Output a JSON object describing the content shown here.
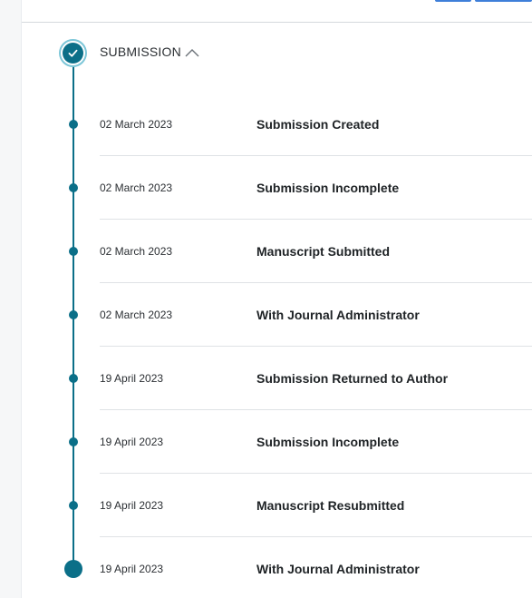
{
  "section": {
    "title": "SUBMISSION",
    "collapse_icon": "chevron-up-icon",
    "status_icon": "check-icon"
  },
  "colors": {
    "accent": "#0b6f88",
    "divider": "#dfe2e5",
    "text": "#1f2326"
  },
  "events": [
    {
      "date": "02 March 2023",
      "title": "Submission Created"
    },
    {
      "date": "02 March 2023",
      "title": "Submission Incomplete"
    },
    {
      "date": "02 March 2023",
      "title": "Manuscript Submitted"
    },
    {
      "date": "02 March 2023",
      "title": "With Journal Administrator"
    },
    {
      "date": "19 April 2023",
      "title": "Submission Returned to Author"
    },
    {
      "date": "19 April 2023",
      "title": "Submission Incomplete"
    },
    {
      "date": "19 April 2023",
      "title": "Manuscript Resubmitted"
    },
    {
      "date": "19 April 2023",
      "title": "With Journal Administrator"
    }
  ]
}
